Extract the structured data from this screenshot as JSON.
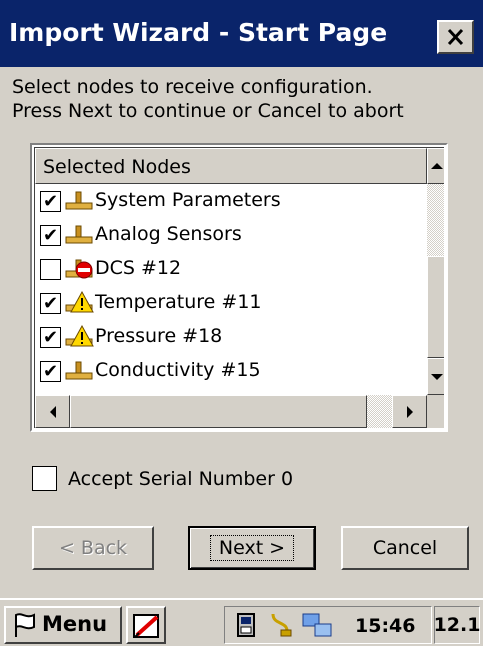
{
  "window": {
    "title": "Import Wizard - Start Page",
    "instructions": [
      "Select nodes to receive configuration.",
      "Press Next to continue or Cancel to abort"
    ]
  },
  "node_list": {
    "header": "Selected Nodes",
    "items": [
      {
        "label": "System Parameters",
        "checked": true,
        "icon": "node-icon",
        "check_mark": "✔"
      },
      {
        "label": "Analog Sensors",
        "checked": true,
        "icon": "node-icon",
        "check_mark": "✔"
      },
      {
        "label": "DCS #12",
        "checked": false,
        "icon": "node-error-icon",
        "check_mark": ""
      },
      {
        "label": "Temperature #11",
        "checked": true,
        "icon": "node-warning-icon",
        "check_mark": "✔"
      },
      {
        "label": "Pressure #18",
        "checked": true,
        "icon": "node-warning-icon",
        "check_mark": "✔"
      },
      {
        "label": "Conductivity #15",
        "checked": true,
        "icon": "node-icon",
        "check_mark": "✔"
      }
    ]
  },
  "accept_serial": {
    "label": "Accept Serial Number 0",
    "checked": false
  },
  "buttons": {
    "back": "< Back",
    "next": "Next >",
    "cancel": "Cancel"
  },
  "taskbar": {
    "menu": "Menu",
    "clock": "15:46",
    "sip": "12.1"
  },
  "colors": {
    "titlebar": "#0a246a",
    "face": "#d4d0c8",
    "warning": "#ffd800",
    "error": "#e00000"
  }
}
